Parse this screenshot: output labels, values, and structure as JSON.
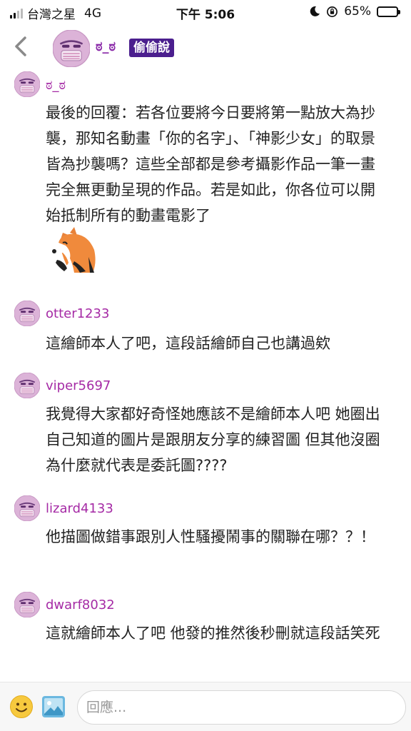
{
  "status_bar": {
    "carrier": "台灣之星",
    "network": "4G",
    "time": "下午 5:06",
    "battery": "65%",
    "battery_level": 0.65
  },
  "header": {
    "back_icon": "chevron-left-icon",
    "name": "ಠ_ಠ",
    "badge": "偷偷說"
  },
  "comments": [
    {
      "name": "ಠ_ಠ",
      "text": "最後的回覆：若各位要將今日要將第一點放大為抄襲，那知名動畫「你的名字」、「神影少女」的取景皆為抄襲嗎？這些全部都是參考攝影作品一筆一畫完全無更動呈現的作品。若是如此，你各位可以開始抵制所有的動畫電影了",
      "sticker": "fox-sticker"
    },
    {
      "name": "otter1233",
      "text": "這繪師本人了吧，這段話繪師自己也講過欸"
    },
    {
      "name": "viper5697",
      "text": "我覺得大家都好奇怪她應該不是繪師本人吧 她圈出自己知道的圖片是跟朋友分享的練習圖 但其他沒圈為什麼就代表是委託圖????"
    },
    {
      "name": "lizard4133",
      "text": "他描圖做錯事跟別人性騷擾鬧事的關聯在哪？？！"
    },
    {
      "name": "dwarf8032",
      "text": "這就繪師本人了吧 他發的推然後秒刪就這段話笑死"
    }
  ],
  "reply_bar": {
    "placeholder": "回應...",
    "emoji_icon": "smiley-icon",
    "image_icon": "image-icon"
  },
  "colors": {
    "username": "#a52aa5",
    "badge_bg": "#4b1f8e",
    "avatar": "#d9a8d6"
  }
}
